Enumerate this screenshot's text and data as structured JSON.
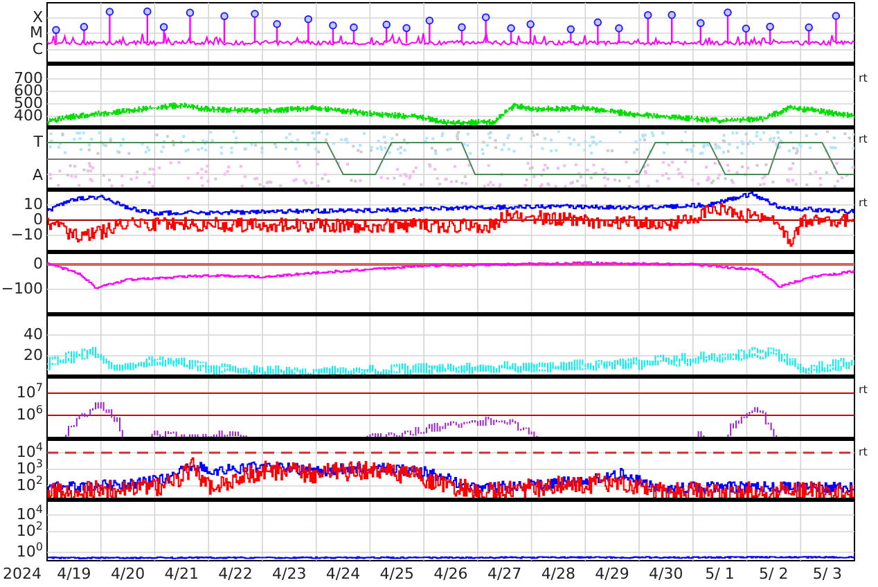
{
  "panels": [
    {
      "ticks": [
        "X",
        "M",
        "C"
      ]
    },
    {
      "ticks": [
        "700",
        "600",
        "500",
        "400"
      ],
      "right_label": "rt"
    },
    {
      "ticks": [
        "T",
        "A"
      ],
      "right_label": "rt"
    },
    {
      "ticks": [
        "10",
        "0",
        "−10"
      ],
      "right_label": "rt"
    },
    {
      "ticks": [
        "0",
        "−100"
      ]
    },
    {
      "ticks": [
        "40",
        "20"
      ]
    },
    {
      "ticks": [
        "10$^{7}$",
        "10$^{6}$"
      ],
      "right_label": "rt"
    },
    {
      "ticks": [
        "10$^{4}$",
        "10$^{3}$",
        "10$^{2}$"
      ],
      "right_label": "rt"
    },
    {
      "ticks": [
        "10$^{4}$",
        "10$^{2}$",
        "10$^{0}$"
      ]
    }
  ],
  "year": "2024",
  "dates": [
    "4/19",
    "4/20",
    "4/21",
    "4/22",
    "4/23",
    "4/24",
    "4/25",
    "4/26",
    "4/27",
    "4/28",
    "4/29",
    "4/30",
    "5/ 1",
    "5/ 2",
    "5/ 3"
  ]
}
